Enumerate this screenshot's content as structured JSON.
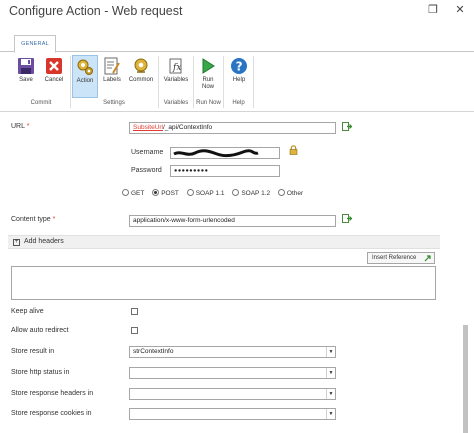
{
  "window": {
    "title": "Configure Action - Web request",
    "restore_glyph": "❐",
    "close_glyph": "✕"
  },
  "ribbon": {
    "tab": "GENERAL",
    "buttons": [
      {
        "label": "Save",
        "icon": "save-icon"
      },
      {
        "label": "Cancel",
        "icon": "cancel-icon"
      },
      {
        "label": "Action",
        "icon": "action-icon"
      },
      {
        "label": "Labels",
        "icon": "labels-icon"
      },
      {
        "label": "Common",
        "icon": "common-icon"
      },
      {
        "label": "Variables",
        "icon": "variables-icon"
      },
      {
        "label": "Run Now",
        "icon": "run-icon"
      },
      {
        "label": "Help",
        "icon": "help-icon"
      }
    ],
    "groups": [
      "Commit",
      "Settings",
      "Variables",
      "Run Now",
      "Help"
    ]
  },
  "form": {
    "url": {
      "label": "URL",
      "required_mark": "*",
      "ref": "SubsiteUrl",
      "rest": "/_api/ContextInfo"
    },
    "username": {
      "label": "Username"
    },
    "password": {
      "label": "Password",
      "value": "●●●●●●●●●"
    },
    "methods": [
      {
        "label": "GET",
        "selected": false
      },
      {
        "label": "POST",
        "selected": true
      },
      {
        "label": "SOAP 1.1",
        "selected": false
      },
      {
        "label": "SOAP 1.2",
        "selected": false
      },
      {
        "label": "Other",
        "selected": false
      }
    ],
    "content_type": {
      "label": "Content type",
      "required_mark": "*",
      "value": "application/x-www-form-urlencoded"
    },
    "add_headers": {
      "expand_glyph": "+",
      "label": "Add headers"
    },
    "insert_reference": "Insert Reference",
    "keep_alive": "Keep alive",
    "allow_auto_redirect": "Allow auto redirect",
    "store_result": {
      "label": "Store result in",
      "value": "strContextInfo"
    },
    "store_http_status": {
      "label": "Store http status in",
      "value": ""
    },
    "store_response_headers": {
      "label": "Store response headers in",
      "value": ""
    },
    "store_response_cookies": {
      "label": "Store response cookies in",
      "value": ""
    }
  },
  "colors": {
    "accent": "#3a6da8",
    "required": "#e03c31",
    "selected_btn": "#cce4f7"
  }
}
